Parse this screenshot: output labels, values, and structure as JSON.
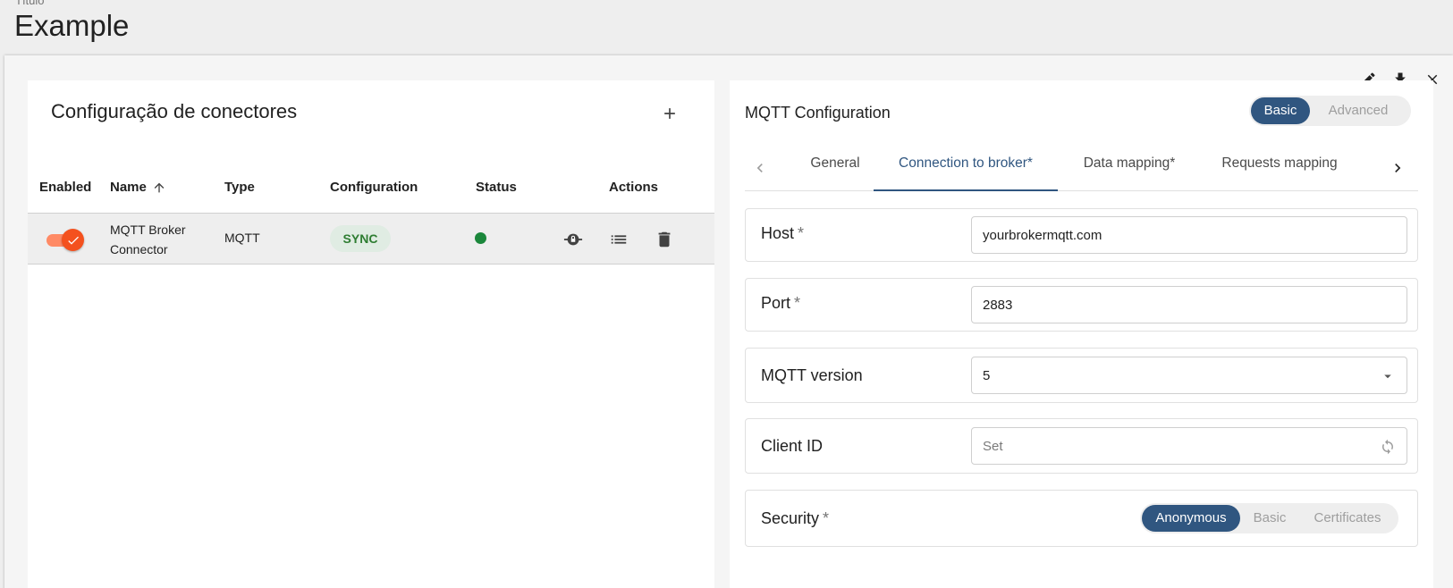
{
  "page": {
    "subtitle": "Título",
    "title": "Example"
  },
  "window_actions": {
    "edit_icon": "pencil-icon",
    "download_icon": "download-icon",
    "close_icon": "close-icon"
  },
  "connectors": {
    "title": "Configuração de conectores",
    "add_icon": "plus-icon",
    "columns": [
      "Enabled",
      "Name",
      "Type",
      "Configuration",
      "Status",
      "Actions"
    ],
    "sort_icon": "arrow-up-icon",
    "rows": [
      {
        "enabled": true,
        "name": "MQTT Broker Connector",
        "type": "MQTT",
        "configuration": "SYNC",
        "status_color": "#1b873b",
        "actions": [
          "rpc-lock-icon",
          "list-icon",
          "delete-icon"
        ]
      }
    ]
  },
  "config": {
    "title": "MQTT Configuration",
    "modes": [
      "Basic",
      "Advanced"
    ],
    "active_mode": "Basic",
    "tabs": [
      "General",
      "Connection to broker*",
      "Data mapping*",
      "Requests mapping"
    ],
    "active_tab": "Connection to broker*",
    "fields": {
      "host": {
        "label": "Host",
        "required": "*",
        "value": "yourbrokermqtt.com"
      },
      "port": {
        "label": "Port",
        "required": "*",
        "value": "2883"
      },
      "version": {
        "label": "MQTT version",
        "value": "5"
      },
      "client_id": {
        "label": "Client ID",
        "placeholder": "Set"
      },
      "security": {
        "label": "Security",
        "required": "*",
        "options": [
          "Anonymous",
          "Basic",
          "Certificates"
        ],
        "selected": "Anonymous"
      }
    }
  },
  "colors": {
    "accent": "#305680",
    "toggle_on": "#f4511e",
    "sync_text": "#2e7d32"
  }
}
